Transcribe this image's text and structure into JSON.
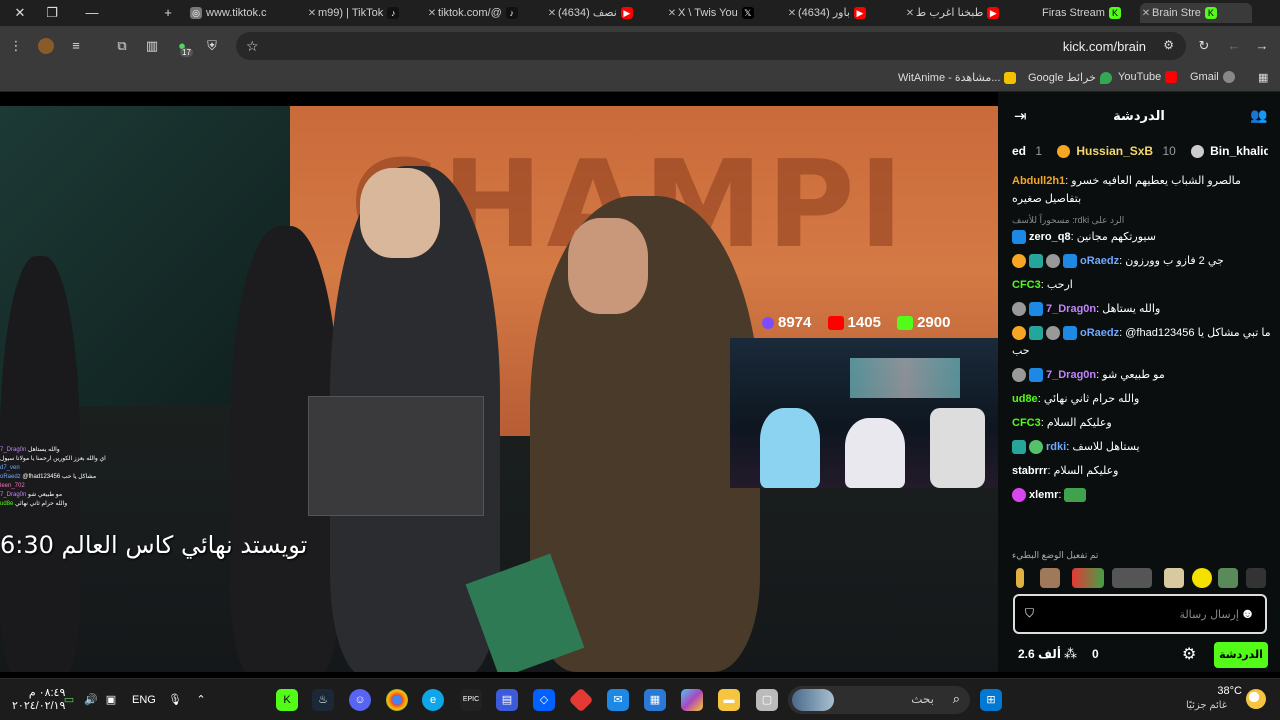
{
  "tabs": [
    {
      "label": "www.tiktok.c",
      "icon": "globe-icon",
      "color": "#777777"
    },
    {
      "label": "m99) | TikTok",
      "icon": "tiktok-icon",
      "color": "#111111"
    },
    {
      "label": "tiktok.com/@",
      "icon": "tiktok-icon",
      "color": "#111111"
    },
    {
      "label": "(4634) نصف",
      "icon": "youtube-icon",
      "color": "#ff0000"
    },
    {
      "label": "X \\ Twis You",
      "icon": "x-icon",
      "color": "#000000"
    },
    {
      "label": "(4634) باور",
      "icon": "youtube-icon",
      "color": "#ff0000"
    },
    {
      "label": "طبخنا اغرب ط",
      "icon": "youtube-icon",
      "color": "#ff0000"
    },
    {
      "label": "Firas Stream",
      "icon": "kick-icon",
      "color": "#53fc18"
    },
    {
      "label": "Brain Stre",
      "icon": "kick-icon",
      "color": "#53fc18"
    }
  ],
  "address": {
    "url": "kick.com/brain"
  },
  "bookmarks": [
    {
      "label": "Gmail",
      "color": "#ea4335"
    },
    {
      "label": "YouTube",
      "color": "#ff0000"
    },
    {
      "label": "Google خرائط",
      "color": "#34a853"
    },
    {
      "label": "WitAnime - مشاهدة...",
      "color": "#f2c200"
    }
  ],
  "toolbar": {
    "extension_badge": "17"
  },
  "video": {
    "overlay_title": "تويستد نهائي كاس العالم 6:30",
    "stats": {
      "kick_viewers": "8974",
      "youtube_viewers": "1405",
      "kick_count": "2900"
    },
    "overlay_chat": [
      {
        "user": "7_Drag0n",
        "text": "والله يستاهل"
      },
      {
        "user": "",
        "text": "اي والله بعزز الكورين ارحمنا يا مولانا سيول"
      },
      {
        "user": "d7_ven",
        "text": ""
      },
      {
        "user": "oRaedz",
        "text": "@fhad123456 مشاكل يا حب"
      },
      {
        "user": "leen_702",
        "text": ""
      },
      {
        "user": "7_Drag0n",
        "text": "مو طبيعي شو"
      },
      {
        "user": "ud8e",
        "text": "والله حرام ثاني نهائي"
      }
    ]
  },
  "chat": {
    "title": "الدردشة",
    "gifters": [
      {
        "name": "Bin_khalid",
        "count": ""
      },
      {
        "name": "Hussian_SxB",
        "count": "10"
      },
      {
        "name": "ed",
        "count": "1"
      }
    ],
    "messages": [
      {
        "user": "Abdull2h1",
        "color": "#f5a623",
        "text": "مالصرو الشباب يعطيهم العافيه خسرو بتفاصيل صغيره",
        "reply": ""
      },
      {
        "user": "zero_q8",
        "color": "#ffffff",
        "text": "سيورتكهم مجانين",
        "reply": "مسحوراً للأسف :rdki الرد على"
      },
      {
        "user": "oRaedz",
        "color": "#6fa8ff",
        "text": "جي 2 فازو ب وورزون",
        "reply": ""
      },
      {
        "user": "CFC3",
        "color": "#53fc18",
        "text": "ارحب",
        "reply": ""
      },
      {
        "user": "7_Drag0n",
        "color": "#c084fc",
        "text": "والله يستاهل",
        "reply": ""
      },
      {
        "user": "oRaedz",
        "color": "#6fa8ff",
        "text": "@fhad123456 ما تبي مشاكل يا حب",
        "reply": ""
      },
      {
        "user": "7_Drag0n",
        "color": "#c084fc",
        "text": "مو طبيعي شو",
        "reply": ""
      },
      {
        "user": "ud8e",
        "color": "#53fc18",
        "text": "والله حرام ثاني نهائي",
        "reply": ""
      },
      {
        "user": "CFC3",
        "color": "#53fc18",
        "text": "وعليكم السلام",
        "reply": ""
      },
      {
        "user": "rdki",
        "color": "#6fa8ff",
        "text": "يستاهل للاسف",
        "reply": ""
      },
      {
        "user": "stabrrr",
        "color": "#ffffff",
        "text": "وعليكم السلام",
        "reply": ""
      },
      {
        "user": "xlemr",
        "color": "#ffffff",
        "text": "",
        "reply": ""
      }
    ],
    "emote_notice": "تم تفعيل الوضع البطيء",
    "input_placeholder": "إرسال رسالة",
    "footer": {
      "count_a": "0",
      "count_b": "2.6 ألف",
      "send_label": "الدردشة"
    }
  },
  "taskbar": {
    "weather_temp": "38°C",
    "weather_desc": "غائم جزئيًا",
    "search_placeholder": "بحث",
    "lang": "ENG",
    "time": "٠٨:٤٩ م",
    "date": "٢٠٢٤/٠٢/١٩"
  }
}
